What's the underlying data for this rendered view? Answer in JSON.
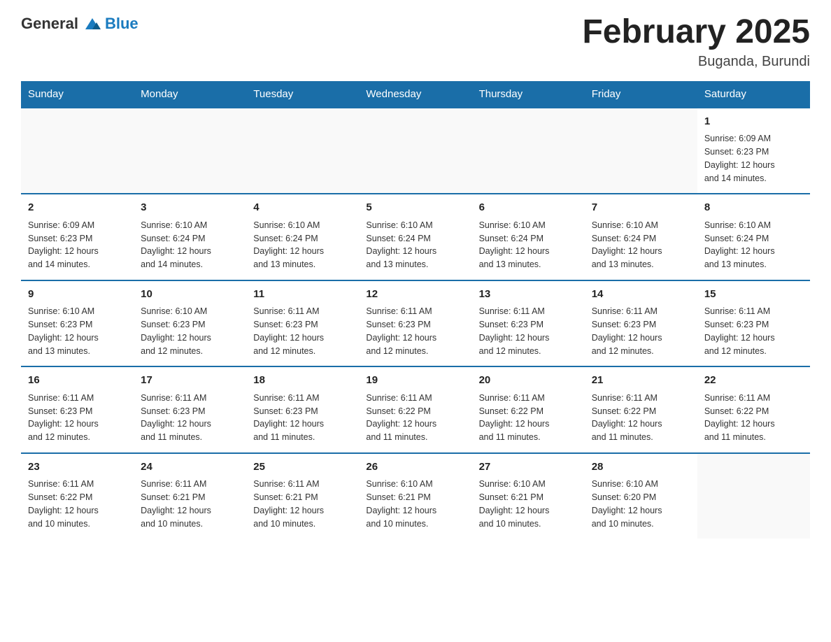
{
  "header": {
    "logo": {
      "general": "General",
      "blue": "Blue"
    },
    "title": "February 2025",
    "location": "Buganda, Burundi"
  },
  "weekdays": [
    "Sunday",
    "Monday",
    "Tuesday",
    "Wednesday",
    "Thursday",
    "Friday",
    "Saturday"
  ],
  "weeks": [
    [
      {
        "day": "",
        "info": ""
      },
      {
        "day": "",
        "info": ""
      },
      {
        "day": "",
        "info": ""
      },
      {
        "day": "",
        "info": ""
      },
      {
        "day": "",
        "info": ""
      },
      {
        "day": "",
        "info": ""
      },
      {
        "day": "1",
        "info": "Sunrise: 6:09 AM\nSunset: 6:23 PM\nDaylight: 12 hours\nand 14 minutes."
      }
    ],
    [
      {
        "day": "2",
        "info": "Sunrise: 6:09 AM\nSunset: 6:23 PM\nDaylight: 12 hours\nand 14 minutes."
      },
      {
        "day": "3",
        "info": "Sunrise: 6:10 AM\nSunset: 6:24 PM\nDaylight: 12 hours\nand 14 minutes."
      },
      {
        "day": "4",
        "info": "Sunrise: 6:10 AM\nSunset: 6:24 PM\nDaylight: 12 hours\nand 13 minutes."
      },
      {
        "day": "5",
        "info": "Sunrise: 6:10 AM\nSunset: 6:24 PM\nDaylight: 12 hours\nand 13 minutes."
      },
      {
        "day": "6",
        "info": "Sunrise: 6:10 AM\nSunset: 6:24 PM\nDaylight: 12 hours\nand 13 minutes."
      },
      {
        "day": "7",
        "info": "Sunrise: 6:10 AM\nSunset: 6:24 PM\nDaylight: 12 hours\nand 13 minutes."
      },
      {
        "day": "8",
        "info": "Sunrise: 6:10 AM\nSunset: 6:24 PM\nDaylight: 12 hours\nand 13 minutes."
      }
    ],
    [
      {
        "day": "9",
        "info": "Sunrise: 6:10 AM\nSunset: 6:23 PM\nDaylight: 12 hours\nand 13 minutes."
      },
      {
        "day": "10",
        "info": "Sunrise: 6:10 AM\nSunset: 6:23 PM\nDaylight: 12 hours\nand 12 minutes."
      },
      {
        "day": "11",
        "info": "Sunrise: 6:11 AM\nSunset: 6:23 PM\nDaylight: 12 hours\nand 12 minutes."
      },
      {
        "day": "12",
        "info": "Sunrise: 6:11 AM\nSunset: 6:23 PM\nDaylight: 12 hours\nand 12 minutes."
      },
      {
        "day": "13",
        "info": "Sunrise: 6:11 AM\nSunset: 6:23 PM\nDaylight: 12 hours\nand 12 minutes."
      },
      {
        "day": "14",
        "info": "Sunrise: 6:11 AM\nSunset: 6:23 PM\nDaylight: 12 hours\nand 12 minutes."
      },
      {
        "day": "15",
        "info": "Sunrise: 6:11 AM\nSunset: 6:23 PM\nDaylight: 12 hours\nand 12 minutes."
      }
    ],
    [
      {
        "day": "16",
        "info": "Sunrise: 6:11 AM\nSunset: 6:23 PM\nDaylight: 12 hours\nand 12 minutes."
      },
      {
        "day": "17",
        "info": "Sunrise: 6:11 AM\nSunset: 6:23 PM\nDaylight: 12 hours\nand 11 minutes."
      },
      {
        "day": "18",
        "info": "Sunrise: 6:11 AM\nSunset: 6:23 PM\nDaylight: 12 hours\nand 11 minutes."
      },
      {
        "day": "19",
        "info": "Sunrise: 6:11 AM\nSunset: 6:22 PM\nDaylight: 12 hours\nand 11 minutes."
      },
      {
        "day": "20",
        "info": "Sunrise: 6:11 AM\nSunset: 6:22 PM\nDaylight: 12 hours\nand 11 minutes."
      },
      {
        "day": "21",
        "info": "Sunrise: 6:11 AM\nSunset: 6:22 PM\nDaylight: 12 hours\nand 11 minutes."
      },
      {
        "day": "22",
        "info": "Sunrise: 6:11 AM\nSunset: 6:22 PM\nDaylight: 12 hours\nand 11 minutes."
      }
    ],
    [
      {
        "day": "23",
        "info": "Sunrise: 6:11 AM\nSunset: 6:22 PM\nDaylight: 12 hours\nand 10 minutes."
      },
      {
        "day": "24",
        "info": "Sunrise: 6:11 AM\nSunset: 6:21 PM\nDaylight: 12 hours\nand 10 minutes."
      },
      {
        "day": "25",
        "info": "Sunrise: 6:11 AM\nSunset: 6:21 PM\nDaylight: 12 hours\nand 10 minutes."
      },
      {
        "day": "26",
        "info": "Sunrise: 6:10 AM\nSunset: 6:21 PM\nDaylight: 12 hours\nand 10 minutes."
      },
      {
        "day": "27",
        "info": "Sunrise: 6:10 AM\nSunset: 6:21 PM\nDaylight: 12 hours\nand 10 minutes."
      },
      {
        "day": "28",
        "info": "Sunrise: 6:10 AM\nSunset: 6:20 PM\nDaylight: 12 hours\nand 10 minutes."
      },
      {
        "day": "",
        "info": ""
      }
    ]
  ]
}
